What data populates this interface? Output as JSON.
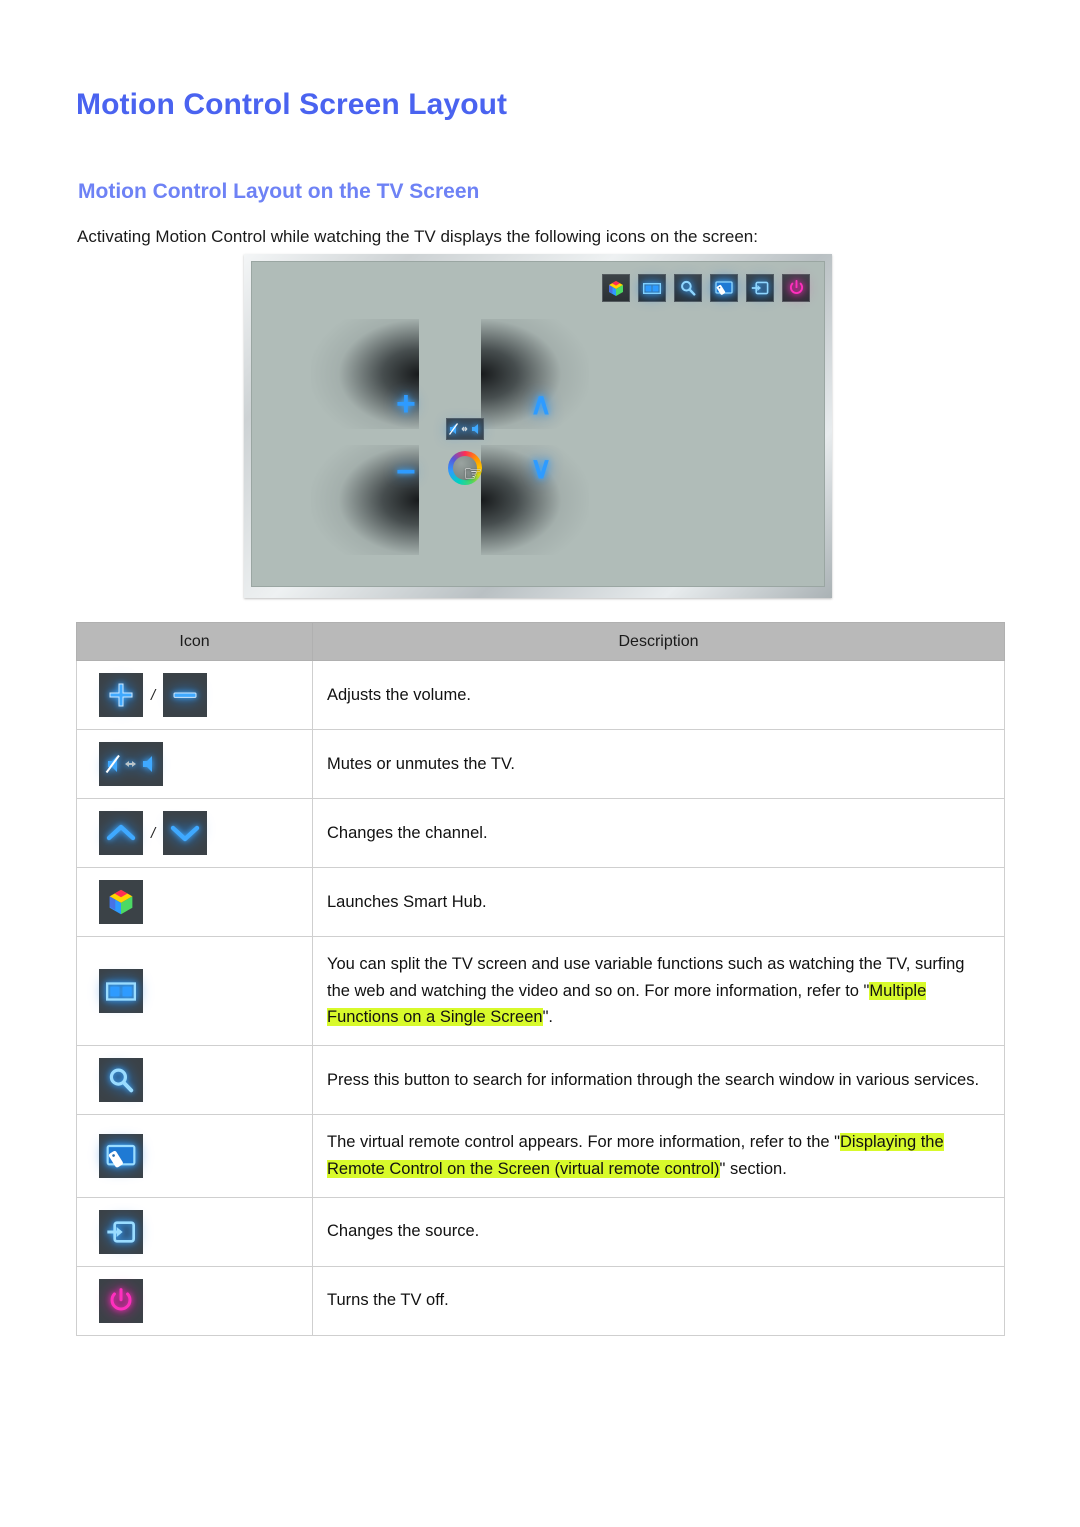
{
  "page": {
    "title": "Motion Control Screen Layout",
    "section_title": "Motion Control Layout on the TV Screen",
    "intro": "Activating Motion Control while watching the TV displays the following icons on the screen:"
  },
  "colors": {
    "title_blue": "#4a63f0",
    "section_blue": "#6e82f5",
    "highlight_yellow": "#d8fa2b",
    "table_header_gray": "#b9b9b9",
    "icon_tile_dark": "#3b4247",
    "neon_blue": "#2e9bff",
    "power_pink": "#ff2fbe",
    "tv_screen_gray": "#b0bcb8"
  },
  "tv_illustration": {
    "name": "motion-control-tv-screen",
    "top_icons": [
      {
        "name": "smart-hub-icon",
        "label": "Smart Hub"
      },
      {
        "name": "multi-link-screen-icon",
        "label": "Multi-Link Screen"
      },
      {
        "name": "search-icon",
        "label": "Search"
      },
      {
        "name": "virtual-remote-icon",
        "label": "Virtual Remote Control"
      },
      {
        "name": "source-icon",
        "label": "Source"
      },
      {
        "name": "power-icon",
        "label": "Power Off"
      }
    ],
    "quadrant_glyphs": [
      {
        "name": "volume-up-glyph",
        "symbol": "+"
      },
      {
        "name": "channel-up-glyph",
        "symbol": "∧"
      },
      {
        "name": "volume-down-glyph",
        "symbol": "−"
      },
      {
        "name": "channel-down-glyph",
        "symbol": "∨"
      }
    ],
    "center": {
      "mute_toggle_name": "mute-toggle-icon",
      "cursor_name": "color-wheel-cursor"
    }
  },
  "table": {
    "headers": {
      "icon": "Icon",
      "description": "Description"
    },
    "rows": [
      {
        "icons": [
          "volume-up-icon",
          "volume-down-icon"
        ],
        "separator": "/",
        "description": "Adjusts the volume."
      },
      {
        "icons": [
          "mute-toggle-icon"
        ],
        "description": "Mutes or unmutes the TV."
      },
      {
        "icons": [
          "channel-up-icon",
          "channel-down-icon"
        ],
        "separator": "/",
        "description": "Changes the channel."
      },
      {
        "icons": [
          "smart-hub-icon"
        ],
        "description": "Launches Smart Hub."
      },
      {
        "icons": [
          "multi-link-screen-icon"
        ],
        "description_pre": "You can split the TV screen and use variable functions such as watching the TV, surfing the web and watching the video and so on. For more information, refer to \"",
        "description_highlight": "Multiple Functions on a Single Screen",
        "description_post": "\"."
      },
      {
        "icons": [
          "search-icon"
        ],
        "description": "Press this button to search for information through the search window in various services."
      },
      {
        "icons": [
          "virtual-remote-icon"
        ],
        "description_pre": "The virtual remote control appears. For more information, refer to the \"",
        "description_highlight": "Displaying the Remote Control on the Screen (virtual remote control)",
        "description_post": "\" section."
      },
      {
        "icons": [
          "source-icon"
        ],
        "description": "Changes the source."
      },
      {
        "icons": [
          "power-icon"
        ],
        "description": "Turns the TV off."
      }
    ]
  }
}
